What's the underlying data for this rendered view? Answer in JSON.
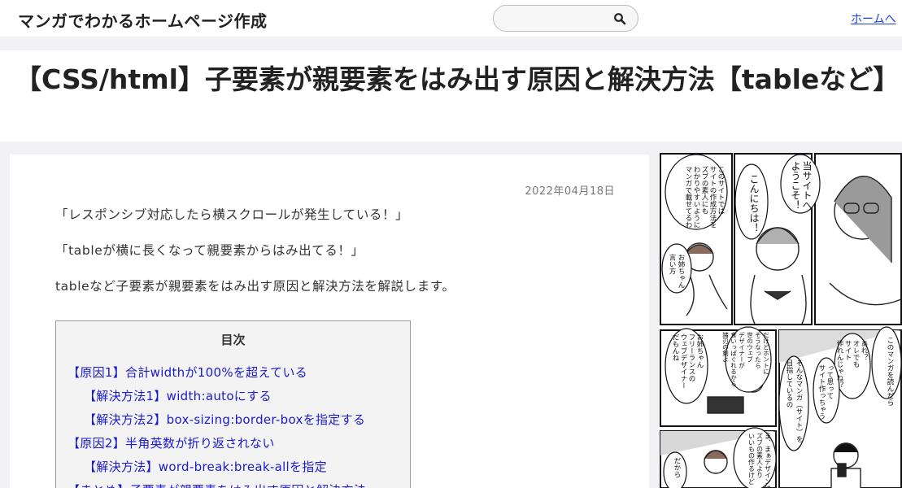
{
  "header": {
    "site_title": "マンガでわかるホームページ作成",
    "search_placeholder": "",
    "home_link": "ホームへ"
  },
  "article": {
    "title": "【CSS/html】子要素が親要素をはみ出す原因と解決方法【tableなど】",
    "date": "2022年04月18日",
    "paragraphs": [
      "「レスポンシブ対応したら横スクロールが発生している！」",
      "「tableが横に長くなって親要素からはみ出てる！」",
      "tableなど子要素が親要素をはみ出す原因と解決方法を解説します。"
    ]
  },
  "toc": {
    "title": "目次",
    "items": [
      "【原因1】合計widthが100%を超えている",
      "【解決方法1】width:autoにする",
      "【解決方法2】box-sizing:border-boxを指定する",
      "【原因2】半角英数が折り返されない",
      "【解決方法】word-break:break-allを指定",
      "【まとめ】子要素が親要素をはみ出す原因と解決方法"
    ]
  },
  "manga": {
    "bubbles": [
      "このサイトでは\nサイトの作成方法を\nズブの素人にも\nわかりやすいように\nマンガで載せてるわ",
      "こんにちは！",
      "当サイトへ\nようこそ！",
      "お姉ちゃん\n言い方",
      "このマンガを読んだら",
      "あれ？\nオレでも\nサイト\n作れんじゃね？",
      "って思って\nサイト作っちゃう",
      "そんなマンガ（サイト）を\n目指しているの",
      "だけど\nホントに\nそうなったら\n世のウェブ\nデザイナーが\n食いっぱぐれるから\n諸刃の剣よ",
      "お姉ちゃん\nフリーランスの\nウェブデザイナー\nだもんね",
      "ま、まぁデザインは\nズブの素人より\nいいもの作るけど",
      "だから"
    ]
  },
  "colors": {
    "link": "#1a1ad0",
    "header_link": "#1a43d6",
    "background": "#f2f2f4"
  }
}
